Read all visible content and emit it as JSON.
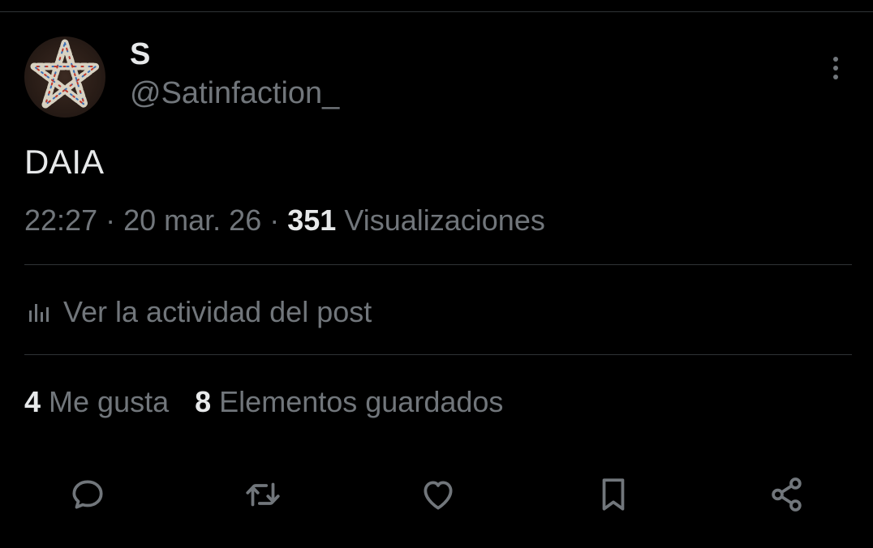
{
  "author": {
    "display_name": "S",
    "handle": "@Satinfaction_",
    "avatar_icon": "pentagram-avatar"
  },
  "post": {
    "text": "DAIA",
    "time": "22:27",
    "separator": "·",
    "date": "20 mar. 26",
    "views_count": "351",
    "views_label": "Visualizaciones"
  },
  "activity": {
    "label": "Ver la actividad del post",
    "icon": "analytics-bar-icon"
  },
  "stats": {
    "likes_count": "4",
    "likes_label": "Me gusta",
    "bookmarks_count": "8",
    "bookmarks_label": "Elementos guardados"
  },
  "actions": {
    "icons": [
      "reply-icon",
      "repost-icon",
      "like-icon",
      "bookmark-icon",
      "share-icon"
    ]
  },
  "colors": {
    "background": "#000000",
    "primary_text": "#e7e9ea",
    "secondary_text": "#71767b",
    "divider": "#2f3336"
  }
}
